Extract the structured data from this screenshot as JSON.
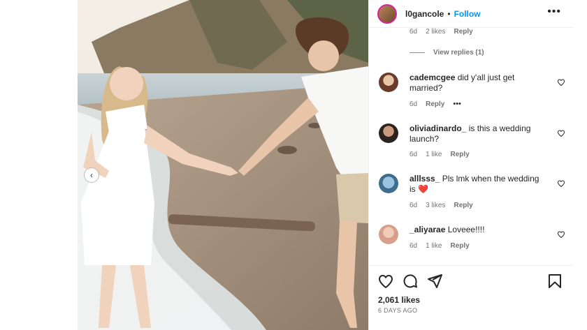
{
  "header": {
    "username": "l0gancole",
    "separator": "•",
    "follow_label": "Follow",
    "more_label": "•••"
  },
  "top_meta": {
    "time": "6d",
    "likes": "2 likes",
    "reply": "Reply"
  },
  "view_replies": {
    "label": "View replies (1)"
  },
  "comments": [
    {
      "user": "cademcgee",
      "text": " did y'all just get married?",
      "time": "6d",
      "likes": "",
      "reply": "Reply",
      "more": "•••"
    },
    {
      "user": "oliviadinardo_",
      "text": " is this a wedding launch?",
      "time": "6d",
      "likes": "1 like",
      "reply": "Reply"
    },
    {
      "user": "alllsss_",
      "text": " Pls lmk when the wedding is ",
      "emoji": "❤️",
      "time": "6d",
      "likes": "3 likes",
      "reply": "Reply"
    },
    {
      "user": "_aliyarae",
      "text": " Loveee!!!!",
      "time": "6d",
      "likes": "1 like",
      "reply": "Reply"
    }
  ],
  "footer": {
    "likes": "2,061 likes",
    "ago": "6 DAYS AGO"
  },
  "carousel": {
    "prev_label": "‹"
  },
  "colors": {
    "accent": "#0095f6",
    "text": "#262626",
    "muted": "#737373",
    "heart_emoji": "#e0245e"
  },
  "icons": [
    "more-icon",
    "heart-icon",
    "comment-icon",
    "share-icon",
    "bookmark-icon",
    "chevron-left-icon"
  ]
}
